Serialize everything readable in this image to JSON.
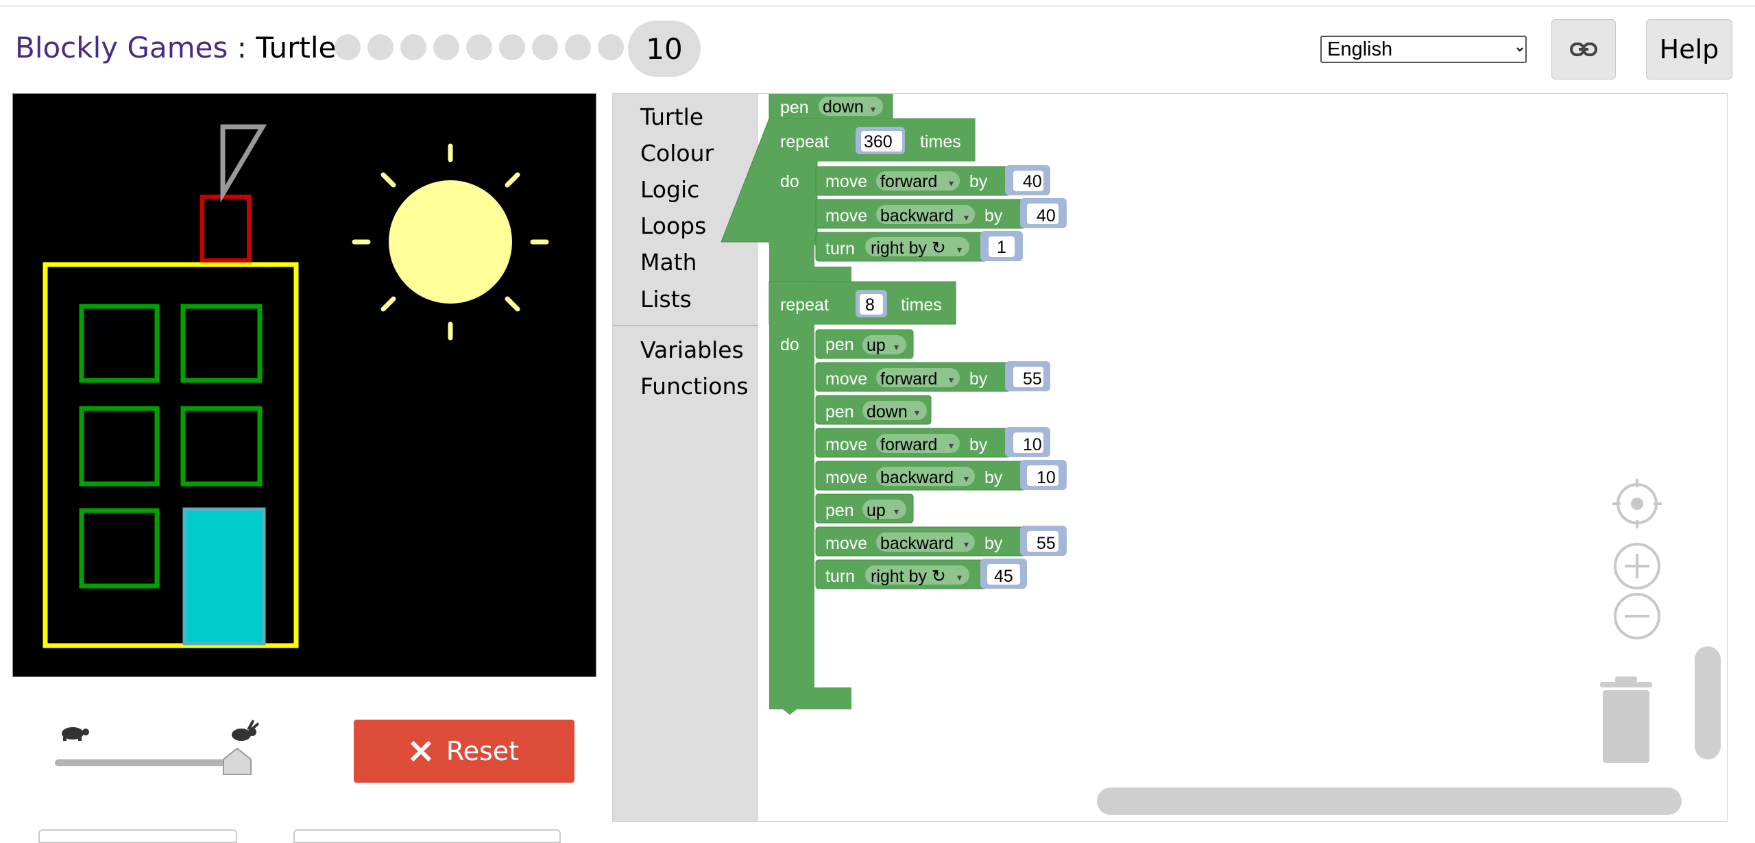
{
  "header": {
    "app_name": "Blockly Games",
    "separator": " : ",
    "level_name": "Turtle",
    "completed_dots": 9,
    "current_level": "10",
    "language": "English",
    "link_icon": "link-icon",
    "help_label": "Help"
  },
  "colors": {
    "app_name": "#4b2a82",
    "block_turtle": "#5ba55b",
    "block_turtle_dark": "#3f8f3f",
    "block_number": "#a5b7d8",
    "reset": "#dd4b39",
    "toolbox": "#dddddd"
  },
  "controls": {
    "speed_slow_icon": "turtle-icon",
    "speed_fast_icon": "rabbit-icon",
    "speed_level": 1.0,
    "reset_label": "Reset",
    "reset_icon": "close-icon"
  },
  "toolbox": {
    "categories": [
      "Turtle",
      "Colour",
      "Logic",
      "Loops",
      "Math",
      "Lists"
    ],
    "categories2": [
      "Variables",
      "Functions"
    ]
  },
  "code": {
    "pen": "pen",
    "down": "down",
    "up": "up",
    "repeat": "repeat",
    "times": "times",
    "do": "do",
    "move": "move",
    "forward": "forward",
    "backward": "backward",
    "by": "by",
    "turn": "turn",
    "right_by": "right by ↻",
    "loop1_count": "360",
    "loop1_forward": "40",
    "loop1_backward": "40",
    "loop1_turn": "1",
    "loop2_count": "8",
    "loop2_forward1": "55",
    "loop2_forward2": "10",
    "loop2_backward1": "10",
    "loop2_backward2": "55",
    "loop2_turn": "45"
  },
  "workspace_icons": {
    "recenter": "target-icon",
    "zoom_in": "zoom-in-icon",
    "zoom_out": "zoom-out-icon",
    "trash": "trash-icon"
  }
}
